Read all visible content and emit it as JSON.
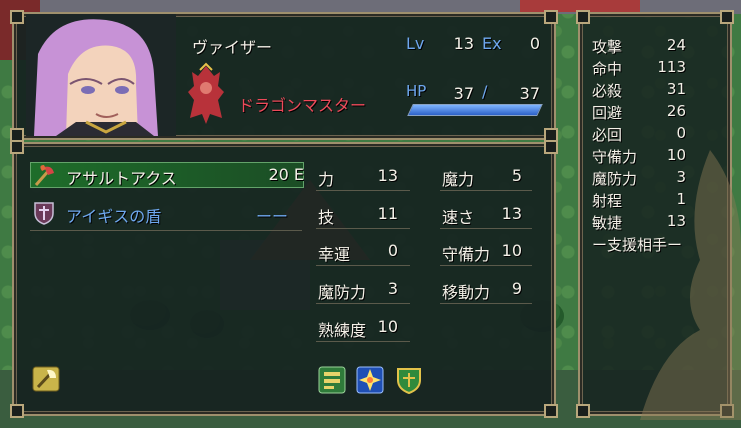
{
  "unit": {
    "name": "ヴァイザー",
    "class": "ドラゴンマスター",
    "lv_label": "Lv",
    "lv": "13",
    "ex_label": "Ex",
    "ex": "0",
    "hp_label": "HP",
    "hp_current": "37",
    "hp_sep": "/",
    "hp_max": "37",
    "hp_fraction": 1.0
  },
  "items": [
    {
      "name": "アサルトアクス",
      "value": "20 E",
      "icon": "axe-icon",
      "selected": true
    },
    {
      "name": "アイギスの盾",
      "value": "ーー",
      "icon": "shield-icon",
      "selected": false
    }
  ],
  "stats": [
    {
      "label": "力",
      "value": "13"
    },
    {
      "label": "魔力",
      "value": "5"
    },
    {
      "label": "技",
      "value": "11"
    },
    {
      "label": "速さ",
      "value": "13"
    },
    {
      "label": "幸運",
      "value": "0"
    },
    {
      "label": "守備力",
      "value": "10"
    },
    {
      "label": "魔防力",
      "value": "3"
    },
    {
      "label": "移動力",
      "value": "9"
    },
    {
      "label": "熟練度",
      "value": "10"
    }
  ],
  "combat": [
    {
      "label": "攻撃",
      "value": "24"
    },
    {
      "label": "命中",
      "value": "113"
    },
    {
      "label": "必殺",
      "value": "31"
    },
    {
      "label": "回避",
      "value": "26"
    },
    {
      "label": "必回",
      "value": "0"
    },
    {
      "label": "守備力",
      "value": "10"
    },
    {
      "label": "魔防力",
      "value": "3"
    },
    {
      "label": "射程",
      "value": "1"
    },
    {
      "label": "敏捷",
      "value": "13"
    }
  ],
  "support_label": "ー支援相手ー",
  "skill_icons": [
    "skill-book-icon",
    "skill-burst-icon",
    "skill-shield-icon"
  ],
  "weapon_rank_icon": "axe-rank-icon",
  "colors": {
    "accent_blue": "#6ea7ee",
    "class_red": "#ee4a5a",
    "hp_fill": "#4d8df0",
    "selected_row": "#1e6d2a"
  }
}
